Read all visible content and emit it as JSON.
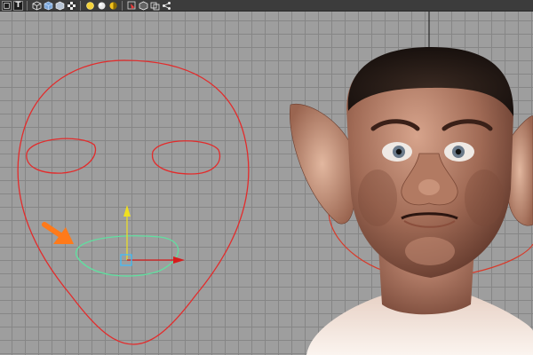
{
  "toolbar": {
    "icons": [
      {
        "name": "camera-view-icon",
        "glyph": "▢"
      },
      {
        "name": "text-tool-icon",
        "glyph": "T"
      },
      {
        "name": "wireframe-cube-icon",
        "glyph": ""
      },
      {
        "name": "smooth-shade-cube-icon",
        "glyph": ""
      },
      {
        "name": "textured-cube-icon",
        "glyph": ""
      },
      {
        "name": "checker-texture-icon",
        "glyph": ""
      },
      {
        "name": "default-light-icon",
        "glyph": ""
      },
      {
        "name": "all-lights-icon",
        "glyph": ""
      },
      {
        "name": "shadow-light-icon",
        "glyph": ""
      },
      {
        "name": "isolate-select-icon",
        "glyph": ""
      },
      {
        "name": "xray-icon",
        "glyph": ""
      },
      {
        "name": "backface-icon",
        "glyph": ""
      },
      {
        "name": "share-icon",
        "glyph": ""
      }
    ]
  },
  "viewport": {
    "grid_color": "#868686",
    "background_color": "#9e9e9e",
    "curve_color": "#e32b2b",
    "selected_curve_color": "#5fe0a0",
    "annotation_arrow_color": "#ff7a1a",
    "manipulator_x_color": "#d81b1b",
    "manipulator_y_color": "#f0e020",
    "pivot_color": "#3bc0ff"
  }
}
